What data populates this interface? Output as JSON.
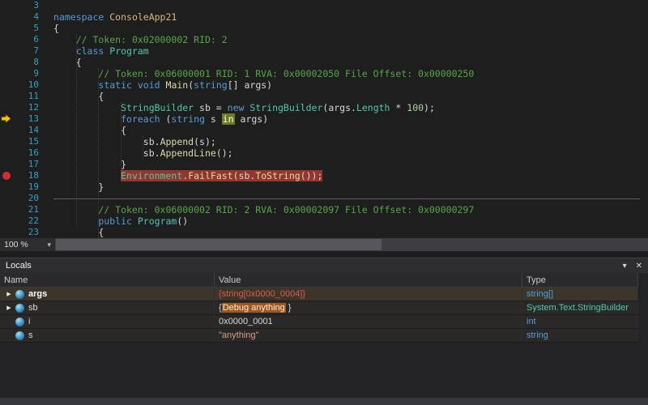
{
  "colors": {
    "keyword_blue": "#569CD6",
    "type_teal": "#4EC9B0",
    "method_yellow": "#DCDCAA",
    "namespace_gold": "#D7BA7D",
    "comment_green": "#57A64A",
    "string_orange": "#D69D85",
    "line_number_teal": "#3AA0C0",
    "breakpoint_red": "#D12F2F",
    "breakpoint_line_bg": "#93362E",
    "current_statement_arrow": "#FFC20E",
    "current_statement_highlight": "#6C7A21",
    "changed_value_red": "#E05A4E",
    "value_highlight_bg": "#A0571E"
  },
  "icons": {
    "chevron_down": "▾",
    "dropdown_arrow": "▾",
    "close": "✕",
    "expander": "▶"
  },
  "editor": {
    "zoom_label": "100 %",
    "lines": [
      {
        "n": 3,
        "ind": 0,
        "tok": []
      },
      {
        "n": 4,
        "ind": 0,
        "tok": [
          {
            "c": "kw",
            "t": "namespace"
          },
          {
            "c": "pl",
            "t": " "
          },
          {
            "c": "ns",
            "t": "ConsoleApp21"
          }
        ]
      },
      {
        "n": 5,
        "ind": 0,
        "tok": [
          {
            "c": "pl",
            "t": "{"
          }
        ]
      },
      {
        "n": 6,
        "ind": 4,
        "tok": [
          {
            "c": "cm",
            "t": "// Token: 0x02000002 RID: 2"
          }
        ]
      },
      {
        "n": 7,
        "ind": 4,
        "tok": [
          {
            "c": "kw",
            "t": "class"
          },
          {
            "c": "pl",
            "t": " "
          },
          {
            "c": "ty",
            "t": "Program"
          }
        ]
      },
      {
        "n": 8,
        "ind": 4,
        "tok": [
          {
            "c": "pl",
            "t": "{"
          }
        ]
      },
      {
        "n": 9,
        "ind": 8,
        "tok": [
          {
            "c": "cm",
            "t": "// Token: 0x06000001 RID: 1 RVA: 0x00002050 File Offset: 0x00000250"
          }
        ]
      },
      {
        "n": 10,
        "ind": 8,
        "tok": [
          {
            "c": "kw",
            "t": "static"
          },
          {
            "c": "pl",
            "t": " "
          },
          {
            "c": "kw",
            "t": "void"
          },
          {
            "c": "pl",
            "t": " "
          },
          {
            "c": "me",
            "t": "Main"
          },
          {
            "c": "pl",
            "t": "("
          },
          {
            "c": "kw",
            "t": "string"
          },
          {
            "c": "pl",
            "t": "[] args)"
          }
        ]
      },
      {
        "n": 11,
        "ind": 8,
        "tok": [
          {
            "c": "pl",
            "t": "{"
          }
        ]
      },
      {
        "n": 12,
        "ind": 12,
        "tok": [
          {
            "c": "ty",
            "t": "StringBuilder"
          },
          {
            "c": "pl",
            "t": " sb = "
          },
          {
            "c": "kw",
            "t": "new"
          },
          {
            "c": "pl",
            "t": " "
          },
          {
            "c": "ty",
            "t": "StringBuilder"
          },
          {
            "c": "pl",
            "t": "(args."
          },
          {
            "c": "ty",
            "t": "Length"
          },
          {
            "c": "pl",
            "t": " * "
          },
          {
            "c": "nu",
            "t": "100"
          },
          {
            "c": "pl",
            "t": ");"
          }
        ]
      },
      {
        "n": 13,
        "ind": 12,
        "glyph": "arrow",
        "tok": [
          {
            "c": "kw",
            "t": "foreach"
          },
          {
            "c": "pl",
            "t": " ("
          },
          {
            "c": "kw",
            "t": "string"
          },
          {
            "c": "pl",
            "t": " s "
          },
          {
            "c": "hl",
            "t": "in"
          },
          {
            "c": "pl",
            "t": " args)"
          }
        ]
      },
      {
        "n": 14,
        "ind": 12,
        "tok": [
          {
            "c": "pl",
            "t": "{"
          }
        ]
      },
      {
        "n": 15,
        "ind": 16,
        "tok": [
          {
            "c": "pl",
            "t": "sb."
          },
          {
            "c": "me",
            "t": "Append"
          },
          {
            "c": "pl",
            "t": "(s);"
          }
        ]
      },
      {
        "n": 16,
        "ind": 16,
        "tok": [
          {
            "c": "pl",
            "t": "sb."
          },
          {
            "c": "me",
            "t": "AppendLine"
          },
          {
            "c": "pl",
            "t": "();"
          }
        ]
      },
      {
        "n": 17,
        "ind": 12,
        "tok": [
          {
            "c": "pl",
            "t": "}"
          }
        ]
      },
      {
        "n": 18,
        "ind": 12,
        "glyph": "breakpoint",
        "bg": "breakpoint",
        "tok": [
          {
            "c": "ty",
            "t": "Environment"
          },
          {
            "c": "pl",
            "t": "."
          },
          {
            "c": "me",
            "t": "FailFast"
          },
          {
            "c": "pl",
            "t": "(sb."
          },
          {
            "c": "me",
            "t": "ToString"
          },
          {
            "c": "pl",
            "t": "());"
          }
        ]
      },
      {
        "n": 19,
        "ind": 8,
        "tok": [
          {
            "c": "pl",
            "t": "}"
          }
        ]
      },
      {
        "n": 20,
        "ind": 0,
        "sep": true,
        "tok": []
      },
      {
        "n": 21,
        "ind": 8,
        "tok": [
          {
            "c": "cm",
            "t": "// Token: 0x06000002 RID: 2 RVA: 0x00002097 File Offset: 0x00000297"
          }
        ]
      },
      {
        "n": 22,
        "ind": 8,
        "tok": [
          {
            "c": "kw",
            "t": "public"
          },
          {
            "c": "pl",
            "t": " "
          },
          {
            "c": "ty",
            "t": "Program"
          },
          {
            "c": "pl",
            "t": "()"
          }
        ]
      },
      {
        "n": 23,
        "ind": 8,
        "tok": [
          {
            "c": "pl",
            "t": "{"
          }
        ]
      }
    ]
  },
  "locals": {
    "title": "Locals",
    "columns": [
      "Name",
      "Value",
      "Type"
    ],
    "rows": [
      {
        "name": "args",
        "bold": true,
        "expander": true,
        "selected": true,
        "icon": "variable-icon",
        "value": [
          {
            "c": "red",
            "t": "{string[0x0000_0004]}"
          }
        ],
        "type": {
          "c": "blue",
          "t": "string[]"
        }
      },
      {
        "name": "sb",
        "bold": false,
        "expander": true,
        "selected": false,
        "icon": "variable-icon",
        "value": [
          {
            "c": "plain",
            "t": "{"
          },
          {
            "c": "hl",
            "t": "Debug anything"
          },
          {
            "c": "plain",
            "t": " }"
          }
        ],
        "type": {
          "c": "teal",
          "t": "System.Text.StringBuilder"
        }
      },
      {
        "name": "i",
        "bold": false,
        "expander": false,
        "selected": false,
        "icon": "variable-icon",
        "value": [
          {
            "c": "plain",
            "t": "0x0000_0001"
          }
        ],
        "type": {
          "c": "blue",
          "t": "int"
        }
      },
      {
        "name": "s",
        "bold": false,
        "expander": false,
        "selected": false,
        "icon": "variable-icon",
        "value": [
          {
            "c": "string",
            "t": "\"anything\""
          }
        ],
        "type": {
          "c": "blue",
          "t": "string"
        }
      }
    ]
  }
}
